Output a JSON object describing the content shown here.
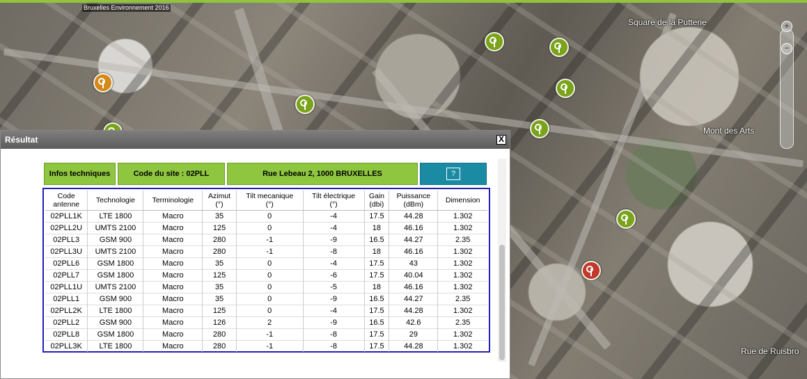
{
  "map": {
    "attribution": "Bruxelles Environnement 2016",
    "labels": {
      "square": "Square de la Putterie",
      "mont": "Mont des Arts",
      "rue": "Rue de Ruisbro"
    },
    "zoom": {
      "plus": "+",
      "minus": "−"
    }
  },
  "panel": {
    "title": "Résultat",
    "close_label": "X",
    "tabs": {
      "info": "Infos techniques",
      "site": "Code du site : 02PLL",
      "address": "Rue Lebeau 2, 1000 BRUXELLES",
      "help": "?"
    },
    "table": {
      "headers": [
        [
          "Code",
          "antenne"
        ],
        [
          "Technologie"
        ],
        [
          "Terminologie"
        ],
        [
          "Azimut",
          "(°)"
        ],
        [
          "Tilt mecanique",
          "(°)"
        ],
        [
          "Tilt électrique",
          "(°)"
        ],
        [
          "Gain",
          "(dbi)"
        ],
        [
          "Puissance",
          "(dBm)"
        ],
        [
          "Dimension"
        ]
      ],
      "rows": [
        [
          "02PLL1K",
          "LTE 1800",
          "Macro",
          "35",
          "0",
          "-4",
          "17.5",
          "44.28",
          "1.302"
        ],
        [
          "02PLL2U",
          "UMTS 2100",
          "Macro",
          "125",
          "0",
          "-4",
          "18",
          "46.16",
          "1.302"
        ],
        [
          "02PLL3",
          "GSM 900",
          "Macro",
          "280",
          "-1",
          "-9",
          "16.5",
          "44.27",
          "2.35"
        ],
        [
          "02PLL3U",
          "UMTS 2100",
          "Macro",
          "280",
          "-1",
          "-8",
          "18",
          "46.16",
          "1.302"
        ],
        [
          "02PLL6",
          "GSM 1800",
          "Macro",
          "35",
          "0",
          "-4",
          "17.5",
          "43",
          "1.302"
        ],
        [
          "02PLL7",
          "GSM 1800",
          "Macro",
          "125",
          "0",
          "-6",
          "17.5",
          "40.04",
          "1.302"
        ],
        [
          "02PLL1U",
          "UMTS 2100",
          "Macro",
          "35",
          "0",
          "-5",
          "18",
          "46.16",
          "1.302"
        ],
        [
          "02PLL1",
          "GSM 900",
          "Macro",
          "35",
          "0",
          "-9",
          "16.5",
          "44.27",
          "2.35"
        ],
        [
          "02PLL2K",
          "LTE 1800",
          "Macro",
          "125",
          "0",
          "-4",
          "17.5",
          "44.28",
          "1.302"
        ],
        [
          "02PLL2",
          "GSM 900",
          "Macro",
          "126",
          "2",
          "-9",
          "16.5",
          "42.6",
          "2.35"
        ],
        [
          "02PLL8",
          "GSM 1800",
          "Macro",
          "280",
          "-1",
          "-8",
          "17.5",
          "29",
          "1.302"
        ],
        [
          "02PLL3K",
          "LTE 1800",
          "Macro",
          "280",
          "-1",
          "-8",
          "17.5",
          "44.28",
          "1.302"
        ]
      ]
    }
  }
}
